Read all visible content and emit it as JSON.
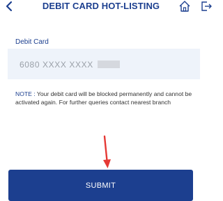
{
  "header": {
    "title": "DEBIT CARD HOT-LISTING",
    "back_icon": "chevron-left-icon",
    "home_icon": "home-icon",
    "logout_icon": "logout-icon"
  },
  "form": {
    "card_label": "Debit Card",
    "card_value": "6080  XXXX  XXXX"
  },
  "note": {
    "prefix": "NOTE :",
    "text": " Your debit card will be blocked permanently and cannot be activated again. For further queries contact nearest branch"
  },
  "actions": {
    "submit_label": "SUBMIT"
  },
  "colors": {
    "primary": "#1c3f8f",
    "field_background": "#eef3fa",
    "annotation_arrow": "#e53935"
  }
}
